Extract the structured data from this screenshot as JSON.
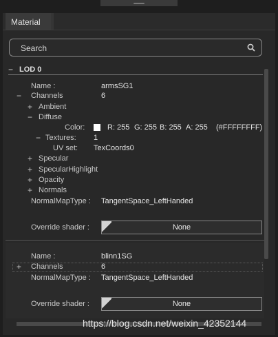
{
  "tab": {
    "label": "Material"
  },
  "search": {
    "placeholder": "Search",
    "icon": "search-icon"
  },
  "lod": {
    "expander": "−",
    "title": "LOD 0"
  },
  "material1": {
    "name_label": "Name    :",
    "name_value": "armsSG1",
    "channels_label": "Channels",
    "channels_value": "6",
    "ambient": "Ambient",
    "diffuse": "Diffuse",
    "color_label": "Color:",
    "color_swatch": "#FFFFFF",
    "r": "R: 255",
    "g": "G: 255",
    "b": "B: 255",
    "a": "A: 255",
    "hex": "(#FFFFFFFF)",
    "textures_label": "Textures:",
    "textures_value": "1",
    "uvset_label": "UV set:",
    "uvset_value": "TexCoords0",
    "specular": "Specular",
    "specular_highlight": "SpecularHighlight",
    "opacity": "Opacity",
    "normals": "Normals",
    "normalmap_label": "NormalMapType :",
    "normalmap_value": "TangentSpace_LeftHanded",
    "override_label": "Override shader :",
    "override_value": "None"
  },
  "material2": {
    "name_label": "Name    :",
    "name_value": "blinn1SG",
    "channels_label": "Channels",
    "channels_value": "6",
    "normalmap_label": "NormalMapType :",
    "normalmap_value": "TangentSpace_LeftHanded",
    "override_label": "Override shader :",
    "override_value": "None"
  },
  "symbols": {
    "plus": "+",
    "minus": "−"
  },
  "watermark": "https://blog.csdn.net/weixin_42352144"
}
